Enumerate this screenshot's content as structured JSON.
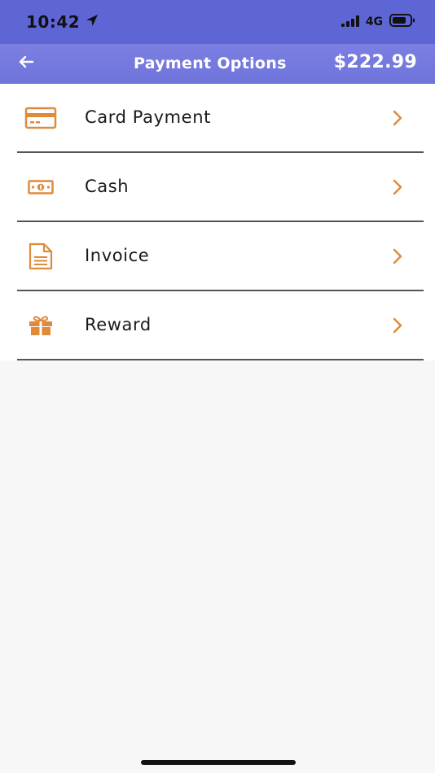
{
  "status_bar": {
    "time": "10:42",
    "network": "4G"
  },
  "header": {
    "title": "Payment Options",
    "amount": "$222.99"
  },
  "options": [
    {
      "label": "Card Payment",
      "icon": "credit-card-icon"
    },
    {
      "label": "Cash",
      "icon": "cash-icon"
    },
    {
      "label": "Invoice",
      "icon": "invoice-icon"
    },
    {
      "label": "Reward",
      "icon": "gift-icon"
    }
  ],
  "colors": {
    "header": "#6f74db",
    "status_bar": "#5e66d6",
    "accent": "#e08a3c",
    "divider": "#555555"
  }
}
